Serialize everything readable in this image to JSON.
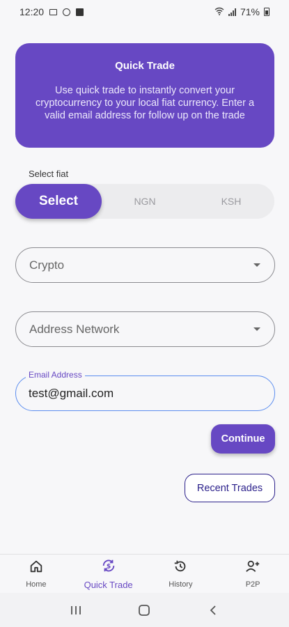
{
  "status_bar": {
    "time": "12:20",
    "battery": "71%"
  },
  "header": {
    "title": "Quick Trade",
    "description": "Use quick trade to instantly convert your cryptocurrency to your local fiat currency. Enter a valid email address for follow up on the trade"
  },
  "fiat": {
    "label": "Select fiat",
    "options": [
      "Select",
      "NGN",
      "KSH"
    ],
    "selected": "Select"
  },
  "crypto_dropdown": {
    "label": "Crypto"
  },
  "network_dropdown": {
    "label": "Address Network"
  },
  "email": {
    "label": "Email Address",
    "value": "test@gmail.com"
  },
  "buttons": {
    "continue": "Continue",
    "recent_trades": "Recent Trades"
  },
  "bottom_nav": {
    "items": [
      {
        "label": "Home",
        "icon": "home-icon"
      },
      {
        "label": "Quick Trade",
        "icon": "exchange-dollar-icon"
      },
      {
        "label": "History",
        "icon": "history-icon"
      },
      {
        "label": "P2P",
        "icon": "add-user-icon"
      }
    ],
    "active": "Quick Trade"
  },
  "colors": {
    "primary": "#6748c3",
    "outline_dark": "#2a1f8a",
    "focus_border": "#5b8def"
  }
}
